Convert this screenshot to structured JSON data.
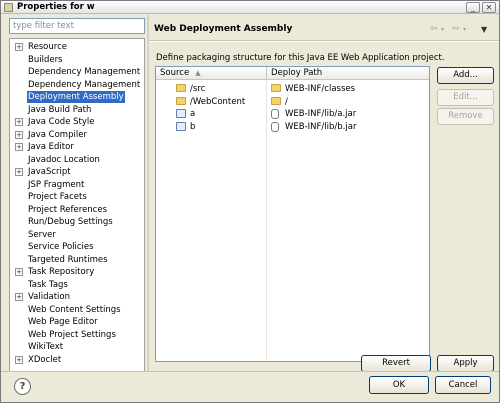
{
  "window": {
    "title": "Properties for w"
  },
  "filter": {
    "placeholder": "type filter text"
  },
  "tree": {
    "items": [
      {
        "label": "Resource",
        "expandable": true
      },
      {
        "label": "Builders",
        "expandable": false
      },
      {
        "label": "Dependency Management",
        "expandable": false
      },
      {
        "label": "Dependency Management",
        "expandable": false
      },
      {
        "label": "Deployment Assembly",
        "expandable": false,
        "selected": true
      },
      {
        "label": "Java Build Path",
        "expandable": false
      },
      {
        "label": "Java Code Style",
        "expandable": true
      },
      {
        "label": "Java Compiler",
        "expandable": true
      },
      {
        "label": "Java Editor",
        "expandable": true
      },
      {
        "label": "Javadoc Location",
        "expandable": false
      },
      {
        "label": "JavaScript",
        "expandable": true
      },
      {
        "label": "JSP Fragment",
        "expandable": false
      },
      {
        "label": "Project Facets",
        "expandable": false
      },
      {
        "label": "Project References",
        "expandable": false
      },
      {
        "label": "Run/Debug Settings",
        "expandable": false
      },
      {
        "label": "Server",
        "expandable": false
      },
      {
        "label": "Service Policies",
        "expandable": false
      },
      {
        "label": "Targeted Runtimes",
        "expandable": false
      },
      {
        "label": "Task Repository",
        "expandable": true
      },
      {
        "label": "Task Tags",
        "expandable": false
      },
      {
        "label": "Validation",
        "expandable": true
      },
      {
        "label": "Web Content Settings",
        "expandable": false
      },
      {
        "label": "Web Page Editor",
        "expandable": false
      },
      {
        "label": "Web Project Settings",
        "expandable": false
      },
      {
        "label": "WikiText",
        "expandable": false
      },
      {
        "label": "XDoclet",
        "expandable": true
      }
    ]
  },
  "page": {
    "title": "Web Deployment Assembly",
    "description": "Define packaging structure for this Java EE Web Application project.",
    "columns": {
      "source": "Source",
      "deploy_path": "Deploy Path"
    },
    "rows": [
      {
        "source": "/src",
        "source_icon": "folder-icon",
        "deploy_path": "WEB-INF/classes",
        "deploy_icon": "folder-icon"
      },
      {
        "source": "/WebContent",
        "source_icon": "folder-icon",
        "deploy_path": "/",
        "deploy_icon": "folder-icon"
      },
      {
        "source": "a",
        "source_icon": "project-icon",
        "deploy_path": "WEB-INF/lib/a.jar",
        "deploy_icon": "jar-icon"
      },
      {
        "source": "b",
        "source_icon": "project-icon",
        "deploy_path": "WEB-INF/lib/b.jar",
        "deploy_icon": "jar-icon"
      }
    ],
    "buttons": {
      "add": "Add...",
      "edit": "Edit...",
      "remove": "Remove",
      "revert": "Revert",
      "apply": "Apply"
    }
  },
  "footer": {
    "help": "?",
    "ok": "OK",
    "cancel": "Cancel"
  },
  "colors": {
    "selection": "#316ac5",
    "face": "#ece9d8",
    "border": "#7f9db9"
  }
}
